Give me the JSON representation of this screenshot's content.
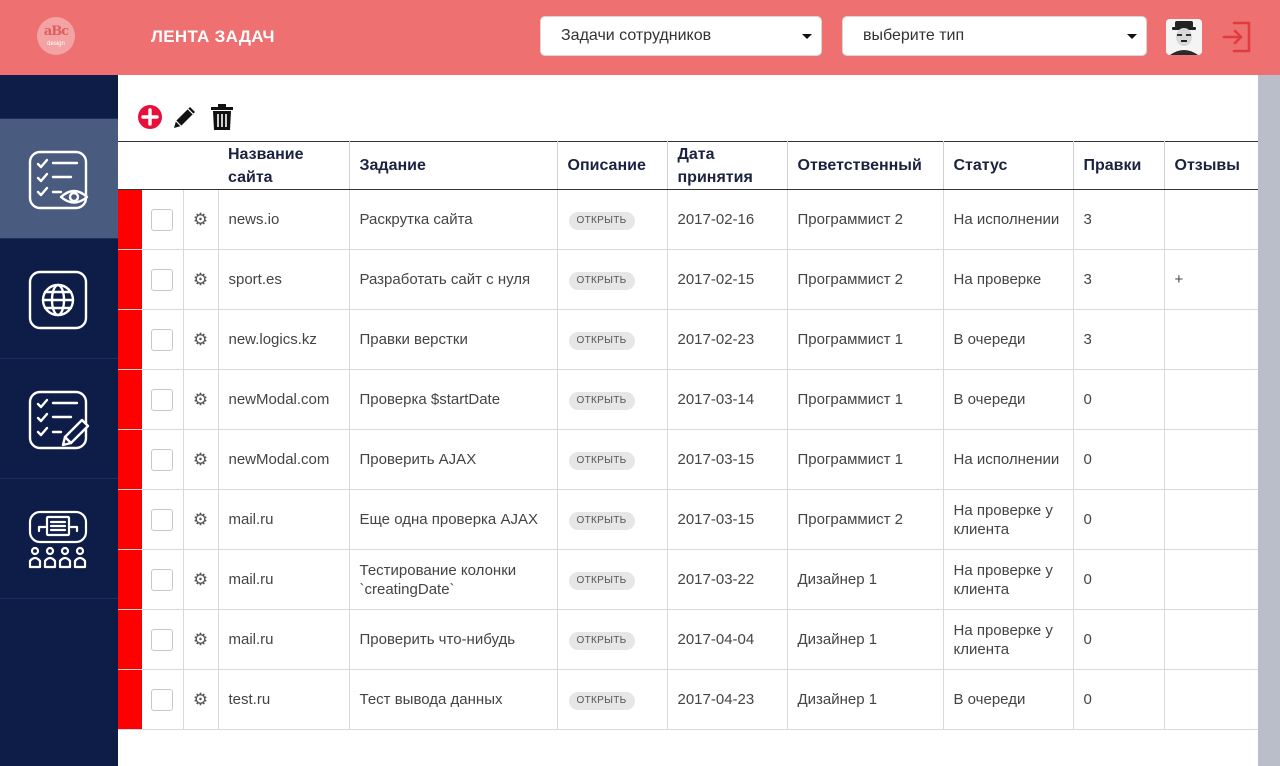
{
  "header": {
    "logo_text": "aBc",
    "logo_sub": "design",
    "title": "ЛЕНТА ЗАДАЧ",
    "employees_select": "Задачи сотрудников",
    "type_select": "выберите тип"
  },
  "sidebar": {
    "items": [
      {
        "name": "tasks-view",
        "active": true
      },
      {
        "name": "sites",
        "active": false
      },
      {
        "name": "tasks-edit",
        "active": false
      },
      {
        "name": "team",
        "active": false
      }
    ]
  },
  "toolbar": {
    "icons": [
      "add-icon",
      "edit-icon",
      "delete-icon"
    ]
  },
  "colors": {
    "header": "#ee7070",
    "sidebar": "#0e1d47",
    "sidebar_active": "#4a5b80",
    "priority": "#ff0000"
  },
  "table": {
    "columns": [
      "Название сайта",
      "Задание",
      "Описание",
      "Дата принятия",
      "Ответственный",
      "Статус",
      "Правки",
      "Отзывы"
    ],
    "open_label": "ОТКРЫТЬ",
    "rows": [
      {
        "site": "news.io",
        "task": "Раскрутка сайта",
        "date": "2017-02-16",
        "owner": "Программист 2",
        "status": "На исполнении",
        "edits": "3",
        "reviews": ""
      },
      {
        "site": "sport.es",
        "task": "Разработать сайт с нуля",
        "date": "2017-02-15",
        "owner": "Программист 2",
        "status": "На проверке",
        "edits": "3",
        "reviews": "+"
      },
      {
        "site": "new.logics.kz",
        "task": "Правки верстки",
        "date": "2017-02-23",
        "owner": "Программист 1",
        "status": "В очереди",
        "edits": "3",
        "reviews": ""
      },
      {
        "site": "newModal.com",
        "task": "Проверка $startDate",
        "date": "2017-03-14",
        "owner": "Программист 1",
        "status": "В очереди",
        "edits": "0",
        "reviews": ""
      },
      {
        "site": "newModal.com",
        "task": "Проверить AJAX",
        "date": "2017-03-15",
        "owner": "Программист 1",
        "status": "На исполнении",
        "edits": "0",
        "reviews": ""
      },
      {
        "site": "mail.ru",
        "task": "Еще одна проверка AJAX",
        "date": "2017-03-15",
        "owner": "Программист 2",
        "status": "На проверке у клиента",
        "edits": "0",
        "reviews": ""
      },
      {
        "site": "mail.ru",
        "task": "Тестирование колонки `creatingDate`",
        "date": "2017-03-22",
        "owner": "Дизайнер 1",
        "status": "На проверке у клиента",
        "edits": "0",
        "reviews": ""
      },
      {
        "site": "mail.ru",
        "task": "Проверить что-нибудь",
        "date": "2017-04-04",
        "owner": "Дизайнер 1",
        "status": "На проверке у клиента",
        "edits": "0",
        "reviews": ""
      },
      {
        "site": "test.ru",
        "task": "Тест вывода данных",
        "date": "2017-04-23",
        "owner": "Дизайнер 1",
        "status": "В очереди",
        "edits": "0",
        "reviews": ""
      }
    ]
  }
}
